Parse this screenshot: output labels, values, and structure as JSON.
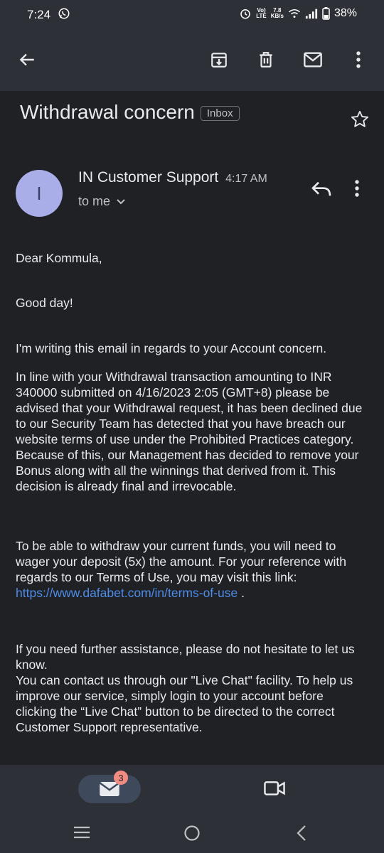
{
  "status_bar": {
    "time": "7:24",
    "network_top": "Vo)",
    "network_bottom": "LTE",
    "speed_top": "7.8",
    "speed_bottom": "KB/s",
    "battery": "38%"
  },
  "email": {
    "subject": "Withdrawal concern",
    "label": "Inbox",
    "sender": "IN Customer Support",
    "time": "4:17 AM",
    "recipient": "to me",
    "avatar_letter": "I",
    "avatar_color": "#a9aee8",
    "body": {
      "greeting": "Dear Kommula,",
      "salutation": "Good day!",
      "p1": "I'm writing this email in regards to your Account concern.",
      "p2": "In line with your Withdrawal transaction amounting to INR 340000 submitted on 4/16/2023 2:05 (GMT+8) please be advised that your Withdrawal request, it has been declined due to our Security Team has detected that you have breach our website terms of use under the Prohibited Practices category. Because of this, our Management has decided to remove your Bonus along with all the winnings that derived from it. This decision is already final and irrevocable.",
      "p3": "To be able to withdraw your current funds, you will need to wager your deposit (5x) the amount. For your reference with regards to our Terms of Use, you may visit this link:",
      "link": "https://www.dafabet.com/in/terms-of-use",
      "link_suffix": " .",
      "p4a": "If you need further assistance, please do not hesitate to let us know.",
      "p4b": "You can contact us through our \"Live Chat\" facility. To help us improve our service, simply login to your account before clicking the “Live Chat” button to be directed to the correct Customer Support representative."
    }
  },
  "bottom_nav": {
    "mail_badge": "3"
  },
  "colors": {
    "background": "#1f2125",
    "bar": "#2d3036",
    "link": "#4d8ce8",
    "badge": "#f28b82"
  },
  "icons": [
    "whatsapp-icon",
    "alarm-icon",
    "wifi-icon",
    "signal-icon",
    "battery-icon",
    "back-arrow-icon",
    "archive-icon",
    "delete-icon",
    "mail-icon",
    "more-vert-icon",
    "star-icon",
    "reply-icon",
    "chevron-down-icon",
    "video-icon",
    "menu-icon",
    "home-icon",
    "back-nav-icon"
  ]
}
